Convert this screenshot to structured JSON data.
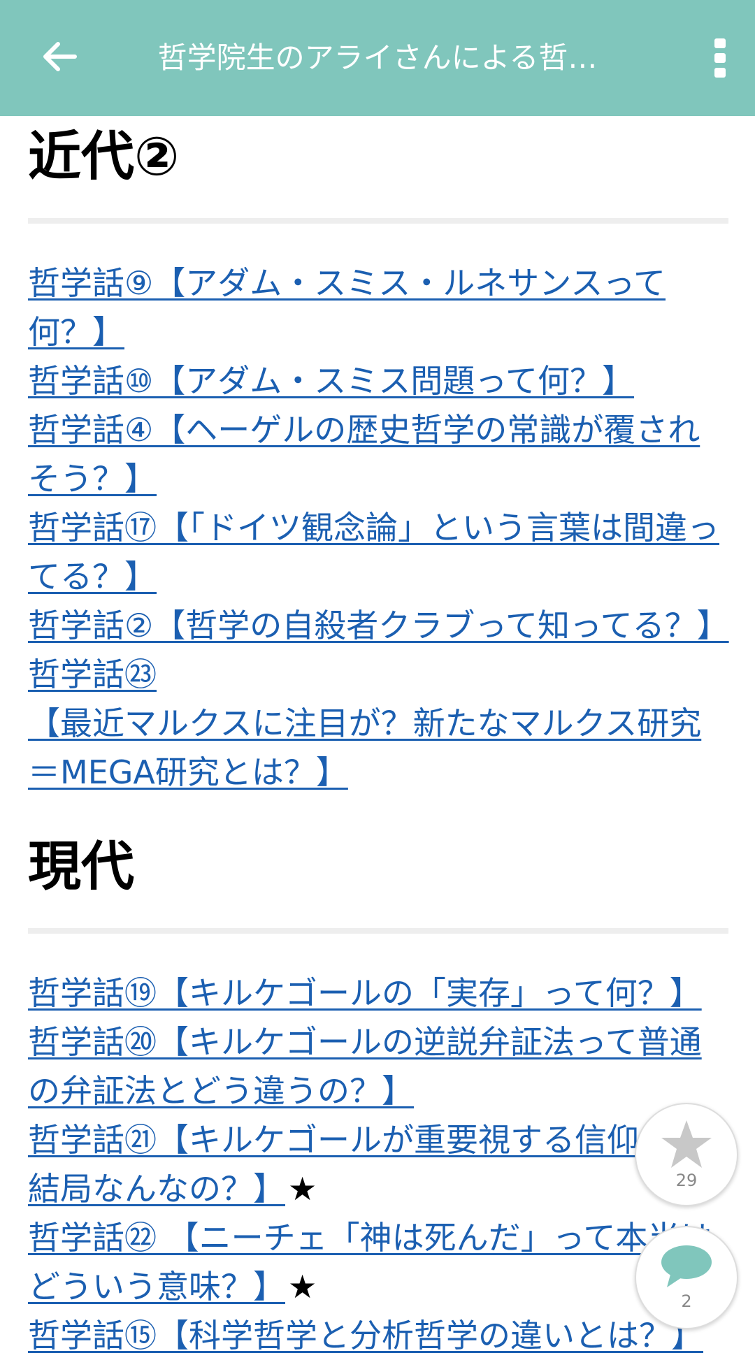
{
  "header": {
    "title": "哲学院生のアライさんによる哲…",
    "bg_color": "#80c6bc",
    "back_icon": "arrow-left-icon",
    "menu_icon": "more-vertical-icon"
  },
  "sections": [
    {
      "title": "近代②",
      "links": [
        {
          "text": "哲学話⑨【アダム・スミス・ルネサンスって何？】",
          "suffix": ""
        },
        {
          "text": "哲学話⑩【アダム・スミス問題って何？】",
          "suffix": ""
        },
        {
          "text": "哲学話④【ヘーゲルの歴史哲学の常識が覆されそう？】",
          "suffix": ""
        },
        {
          "text": "哲学話⑰【「ドイツ観念論」という言葉は間違ってる？】",
          "suffix": ""
        },
        {
          "text": "哲学話②【哲学の自殺者クラブって知ってる？】",
          "suffix": ""
        },
        {
          "text": "哲学話㉓",
          "suffix": ""
        },
        {
          "text": "【最近マルクスに注目が？新たなマルクス研究＝MEGA研究とは？】",
          "suffix": ""
        }
      ]
    },
    {
      "title": "現代",
      "links": [
        {
          "text": "哲学話⑲【キルケゴールの「実存」って何？】",
          "suffix": ""
        },
        {
          "text": "哲学話⑳【キルケゴールの逆説弁証法って普通の弁証法とどう違うの？】",
          "suffix": ""
        },
        {
          "text": "哲学話㉑【キルケゴールが重要視する信仰って結局なんなの？】",
          "suffix": "★"
        },
        {
          "text": "哲学話㉒ 【ニーチェ「神は死んだ」って本当はどういう意味？】",
          "suffix": "★"
        },
        {
          "text": "哲学話⑮【科学哲学と分析哲学の違いとは？】",
          "suffix": ""
        }
      ]
    }
  ],
  "fab": {
    "like_icon": "star-icon",
    "like_count": "29",
    "comment_icon": "comment-bubble-icon",
    "comment_count": "2"
  }
}
